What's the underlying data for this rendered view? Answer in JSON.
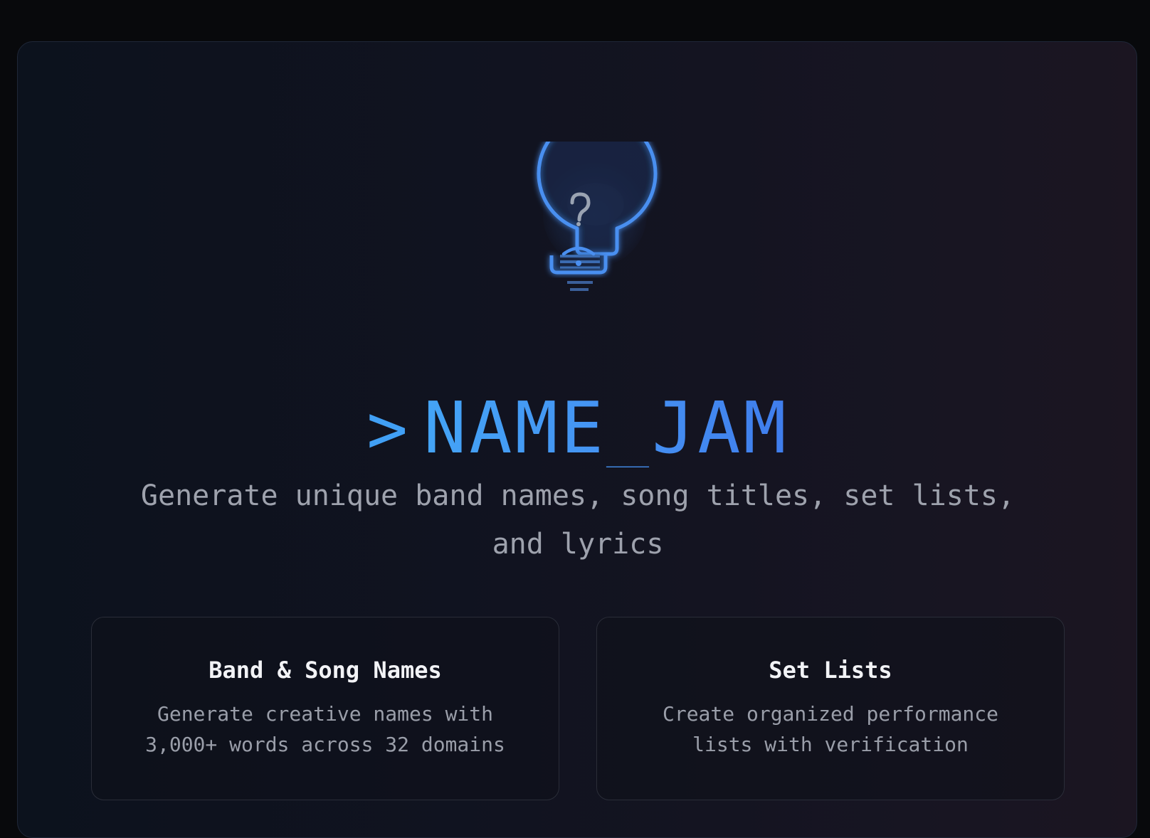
{
  "hero": {
    "icon": "lightbulb-question-icon",
    "accent_color": "#4a8ff0",
    "prompt_symbol": ">",
    "title": "NAME_JAM",
    "tagline": "Generate unique band names, song titles, set lists, and lyrics"
  },
  "features": [
    {
      "title": "Band & Song Names",
      "description": "Generate creative names with 3,000+ words across 32 domains"
    },
    {
      "title": "Set Lists",
      "description": "Create organized performance lists with verification"
    }
  ]
}
